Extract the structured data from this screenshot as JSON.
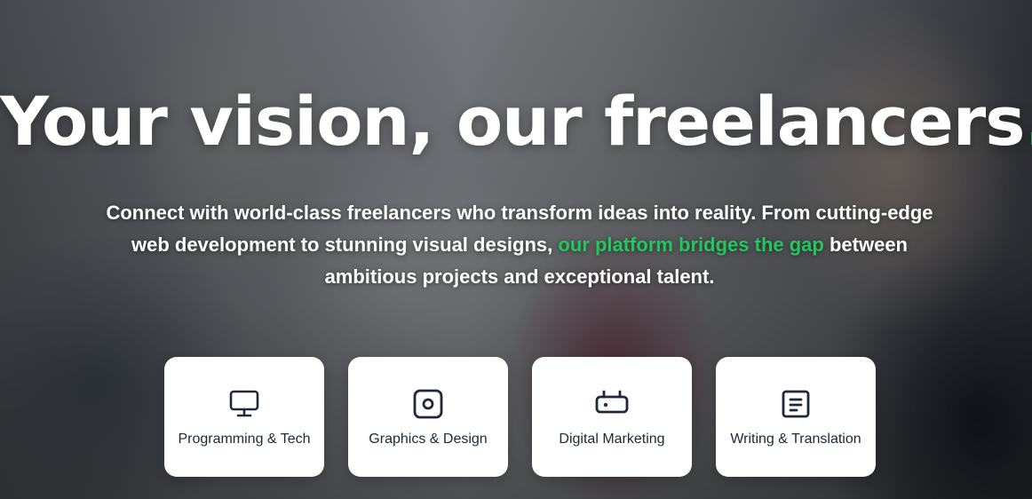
{
  "hero": {
    "title": "Your vision, our freelancers",
    "title_dot": ".",
    "subtitle_part1": "Connect with world-class freelancers who transform ideas into reality. From cutting-edge web development to stunning visual designs, ",
    "subtitle_highlight": "our platform bridges the gap",
    "subtitle_part2": " between ambitious projects and exceptional talent."
  },
  "categories": [
    {
      "label": "Programming & Tech",
      "icon": "monitor-icon"
    },
    {
      "label": "Graphics & Design",
      "icon": "image-frame-icon"
    },
    {
      "label": "Digital Marketing",
      "icon": "tv-icon"
    },
    {
      "label": "Writing & Translation",
      "icon": "document-icon"
    }
  ],
  "colors": {
    "accent": "#22c55e",
    "text": "#ffffff",
    "card_bg": "#ffffff",
    "card_text": "#1f2937"
  }
}
